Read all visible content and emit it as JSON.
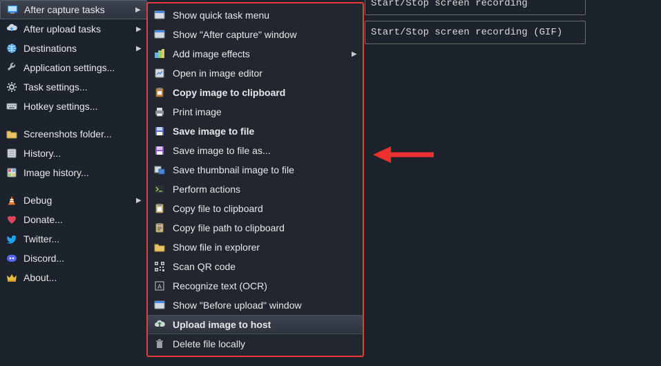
{
  "sidebar": {
    "items": [
      {
        "label": "After capture tasks",
        "icon": "monitor-icon",
        "hasArrow": true,
        "highlighted": true
      },
      {
        "label": "After upload tasks",
        "icon": "cloud-upload-icon",
        "hasArrow": true
      },
      {
        "label": "Destinations",
        "icon": "globe-icon",
        "hasArrow": true
      },
      {
        "label": "Application settings...",
        "icon": "wrench-icon"
      },
      {
        "label": "Task settings...",
        "icon": "gear-icon"
      },
      {
        "label": "Hotkey settings...",
        "icon": "keyboard-icon"
      },
      {
        "gap": true
      },
      {
        "label": "Screenshots folder...",
        "icon": "folder-icon"
      },
      {
        "label": "History...",
        "icon": "history-icon"
      },
      {
        "label": "Image history...",
        "icon": "image-history-icon"
      },
      {
        "gap": true
      },
      {
        "label": "Debug",
        "icon": "cone-icon",
        "hasArrow": true
      },
      {
        "label": "Donate...",
        "icon": "heart-icon"
      },
      {
        "label": "Twitter...",
        "icon": "twitter-icon"
      },
      {
        "label": "Discord...",
        "icon": "discord-icon"
      },
      {
        "label": "About...",
        "icon": "crown-icon"
      }
    ]
  },
  "submenu": {
    "items": [
      {
        "label": "Show quick task menu",
        "icon": "window-icon"
      },
      {
        "label": "Show \"After capture\" window",
        "icon": "window-icon"
      },
      {
        "label": "Add image effects",
        "icon": "effects-icon",
        "hasArrow": true
      },
      {
        "label": "Open in image editor",
        "icon": "editor-icon"
      },
      {
        "label": "Copy image to clipboard",
        "icon": "clipboard-image-icon",
        "bold": true
      },
      {
        "label": "Print image",
        "icon": "printer-icon"
      },
      {
        "label": "Save image to file",
        "icon": "disk-icon",
        "bold": true
      },
      {
        "label": "Save image to file as...",
        "icon": "disk-as-icon"
      },
      {
        "label": "Save thumbnail image to file",
        "icon": "thumbnail-icon"
      },
      {
        "label": "Perform actions",
        "icon": "terminal-icon"
      },
      {
        "label": "Copy file to clipboard",
        "icon": "clipboard-file-icon"
      },
      {
        "label": "Copy file path to clipboard",
        "icon": "clipboard-path-icon"
      },
      {
        "label": "Show file in explorer",
        "icon": "folder-open-icon"
      },
      {
        "label": "Scan QR code",
        "icon": "qr-icon"
      },
      {
        "label": "Recognize text (OCR)",
        "icon": "ocr-icon"
      },
      {
        "label": "Show \"Before upload\" window",
        "icon": "window-icon"
      },
      {
        "label": "Upload image to host",
        "icon": "upload-icon",
        "bold": true,
        "hovered": true
      },
      {
        "label": "Delete file locally",
        "icon": "trash-icon"
      }
    ]
  },
  "hotkeys": {
    "rows": [
      {
        "label": "Start/Stop screen recording"
      },
      {
        "label": "Start/Stop screen recording (GIF)"
      }
    ]
  }
}
